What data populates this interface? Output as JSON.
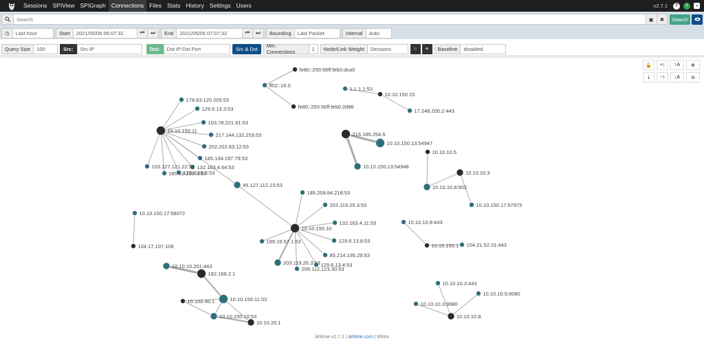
{
  "navbar": {
    "tabs": [
      "Sessions",
      "SPIView",
      "SPIGraph",
      "Connections",
      "Files",
      "Stats",
      "History",
      "Settings",
      "Users"
    ],
    "active": "Connections",
    "version": "v2.7.1"
  },
  "search": {
    "placeholder": "Search",
    "search_label": "Search"
  },
  "time": {
    "range_label": "Last hour",
    "start_label": "Start",
    "start_value": "2021/05/06 06:07:32",
    "end_label": "End",
    "end_value": "2021/05/06 07:07:32",
    "bounding_label": "Bounding",
    "bounding_value": "Last Packet",
    "interval_label": "Interval",
    "interval_value": "Auto"
  },
  "connections": {
    "query_size_label": "Query Size",
    "query_size_value": "100",
    "src_label": "Src:",
    "src_value": "Src IP",
    "dst_label": "Dst:",
    "dst_value": "Dst IP:Dst Port",
    "src_dst_button": "Src & Dst",
    "min_conn_label": "Min. Connections",
    "min_conn_value": "1",
    "weight_label": "Node/Link Weight",
    "weight_value": "Sessions",
    "baseline_label": "Baseline",
    "baseline_value": "disabled"
  },
  "graph": {
    "node_colors": {
      "source": "#2b2b2b",
      "target": "#2f6f7a"
    },
    "nodes": [
      {
        "id": "n1",
        "label": "fe80::250:56ff:feb0:dca0",
        "type": "source",
        "weight": 1
      },
      {
        "id": "n2",
        "label": "ff02::16.0",
        "type": "target",
        "weight": 1
      },
      {
        "id": "n3",
        "label": "fe80::250:56ff:feb0:2d86",
        "type": "source",
        "weight": 1
      },
      {
        "id": "n4",
        "label": "1.1.1.1:53",
        "type": "target",
        "weight": 1
      },
      {
        "id": "n5",
        "label": "10.10.150.15",
        "type": "source",
        "weight": 1
      },
      {
        "id": "n6",
        "label": "17.248.200.2:443",
        "type": "target",
        "weight": 1
      },
      {
        "id": "n7",
        "label": "10.10.150.11",
        "type": "source",
        "weight": 3
      },
      {
        "id": "n8",
        "label": "178.63.120.205:53",
        "type": "target",
        "weight": 1
      },
      {
        "id": "n9",
        "label": "129.6.13.3:53",
        "type": "target",
        "weight": 1
      },
      {
        "id": "n10",
        "label": "103.78.221.91:53",
        "type": "target",
        "weight": 1
      },
      {
        "id": "n11",
        "label": "217.144.132.253:53",
        "type": "target",
        "weight": 1
      },
      {
        "id": "n12",
        "label": "202.202.63.12:53",
        "type": "target",
        "weight": 1
      },
      {
        "id": "n13",
        "label": "185.134.197.79:53",
        "type": "target",
        "weight": 1
      },
      {
        "id": "n14",
        "label": "132.163.4.64:53",
        "type": "target",
        "weight": 1
      },
      {
        "id": "n15",
        "label": "103.127.121.22:53",
        "type": "target",
        "weight": 1
      },
      {
        "id": "n16",
        "label": "185.82.109.3:53",
        "type": "target",
        "weight": 1
      },
      {
        "id": "n17",
        "label": "129.6.13.3:53",
        "type": "target",
        "weight": 1
      },
      {
        "id": "n18",
        "label": "45.127.112.23:53",
        "type": "target",
        "weight": 2
      },
      {
        "id": "n19",
        "label": "216.186.254.5",
        "type": "source",
        "weight": 3
      },
      {
        "id": "n20",
        "label": "10.10.150.13:54947",
        "type": "target",
        "weight": 3
      },
      {
        "id": "n21",
        "label": "10.10.150.13:54948",
        "type": "target",
        "weight": 2
      },
      {
        "id": "n22",
        "label": "10.10.10.5",
        "type": "source",
        "weight": 1
      },
      {
        "id": "n23",
        "label": "10.10.10.8:902",
        "type": "target",
        "weight": 2
      },
      {
        "id": "n24",
        "label": "10.10.10.3",
        "type": "source",
        "weight": 2
      },
      {
        "id": "n25",
        "label": "10.10.150.17:57973",
        "type": "target",
        "weight": 1
      },
      {
        "id": "n26",
        "label": "10.10.150.10",
        "type": "source",
        "weight": 3
      },
      {
        "id": "n27",
        "label": "185.209.84.218:53",
        "type": "target",
        "weight": 1
      },
      {
        "id": "n28",
        "label": "203.119.25.3:53",
        "type": "target",
        "weight": 1
      },
      {
        "id": "n29",
        "label": "132.163.4.11:53",
        "type": "target",
        "weight": 1
      },
      {
        "id": "n30",
        "label": "129.6.13.8:53",
        "type": "target",
        "weight": 1
      },
      {
        "id": "n31",
        "label": "85.214.195.29:53",
        "type": "target",
        "weight": 1
      },
      {
        "id": "n32",
        "label": "199.19.57.1:53",
        "type": "target",
        "weight": 1
      },
      {
        "id": "n33",
        "label": "203.119.26.3:53",
        "type": "target",
        "weight": 2
      },
      {
        "id": "n34",
        "label": "129.6.13.4:53",
        "type": "target",
        "weight": 1
      },
      {
        "id": "n35",
        "label": "209.112.123.30:53",
        "type": "target",
        "weight": 1
      },
      {
        "id": "n36",
        "label": "10.10.150.17:58072",
        "type": "target",
        "weight": 1
      },
      {
        "id": "n37",
        "label": "104.17.107.108",
        "type": "source",
        "weight": 1
      },
      {
        "id": "n38",
        "label": "10.10.10.8:443",
        "type": "target",
        "weight": 1
      },
      {
        "id": "n39",
        "label": "10.10.150.1",
        "type": "source",
        "weight": 1
      },
      {
        "id": "n40",
        "label": "104.21.52.31:443",
        "type": "target",
        "weight": 1
      },
      {
        "id": "n41",
        "label": "10.10.10.201:443",
        "type": "target",
        "weight": 2
      },
      {
        "id": "n42",
        "label": "192.168.2.1",
        "type": "source",
        "weight": 3
      },
      {
        "id": "n43",
        "label": "10.100.40.1",
        "type": "source",
        "weight": 1
      },
      {
        "id": "n44",
        "label": "10.10.150.11:53",
        "type": "target",
        "weight": 3
      },
      {
        "id": "n45",
        "label": "10.10.150.10:53",
        "type": "target",
        "weight": 2
      },
      {
        "id": "n46",
        "label": "10.10.20.1",
        "type": "source",
        "weight": 2
      },
      {
        "id": "n47",
        "label": "10.10.10.3:443",
        "type": "target",
        "weight": 1
      },
      {
        "id": "n48",
        "label": "10.10.10.3:9080",
        "type": "target",
        "weight": 1
      },
      {
        "id": "n49",
        "label": "10.10.10.5:9080",
        "type": "target",
        "weight": 1
      },
      {
        "id": "n50",
        "label": "10.10.10.8",
        "type": "source",
        "weight": 2
      }
    ],
    "links": [
      [
        "n2",
        "n1",
        1
      ],
      [
        "n2",
        "n3",
        1
      ],
      [
        "n4",
        "n5",
        1
      ],
      [
        "n5",
        "n6",
        1
      ],
      [
        "n7",
        "n8",
        1
      ],
      [
        "n7",
        "n9",
        1
      ],
      [
        "n7",
        "n10",
        1
      ],
      [
        "n7",
        "n11",
        1
      ],
      [
        "n7",
        "n12",
        1
      ],
      [
        "n7",
        "n13",
        1
      ],
      [
        "n7",
        "n14",
        1
      ],
      [
        "n7",
        "n15",
        1
      ],
      [
        "n7",
        "n16",
        1
      ],
      [
        "n7",
        "n17",
        1
      ],
      [
        "n7",
        "n18",
        1
      ],
      [
        "n19",
        "n20",
        3
      ],
      [
        "n19",
        "n21",
        3
      ],
      [
        "n22",
        "n23",
        1
      ],
      [
        "n24",
        "n23",
        1
      ],
      [
        "n24",
        "n25",
        1
      ],
      [
        "n18",
        "n26",
        1
      ],
      [
        "n26",
        "n27",
        1
      ],
      [
        "n26",
        "n28",
        1
      ],
      [
        "n26",
        "n29",
        1
      ],
      [
        "n26",
        "n30",
        1
      ],
      [
        "n26",
        "n31",
        1
      ],
      [
        "n26",
        "n32",
        1
      ],
      [
        "n26",
        "n33",
        2
      ],
      [
        "n26",
        "n34",
        1
      ],
      [
        "n26",
        "n35",
        1
      ],
      [
        "n36",
        "n37",
        1
      ],
      [
        "n38",
        "n39",
        1
      ],
      [
        "n39",
        "n40",
        1
      ],
      [
        "n41",
        "n42",
        3
      ],
      [
        "n42",
        "n44",
        2
      ],
      [
        "n43",
        "n44",
        1
      ],
      [
        "n44",
        "n45",
        1
      ],
      [
        "n43",
        "n45",
        1
      ],
      [
        "n45",
        "n46",
        2
      ],
      [
        "n44",
        "n46",
        1
      ],
      [
        "n47",
        "n50",
        1
      ],
      [
        "n48",
        "n50",
        1
      ],
      [
        "n49",
        "n50",
        1
      ]
    ]
  },
  "footer": {
    "version": "Arkime v2.7.1",
    "sep1": "|",
    "link": "arkime.com",
    "sep2": "|",
    "timing": "89ms"
  }
}
